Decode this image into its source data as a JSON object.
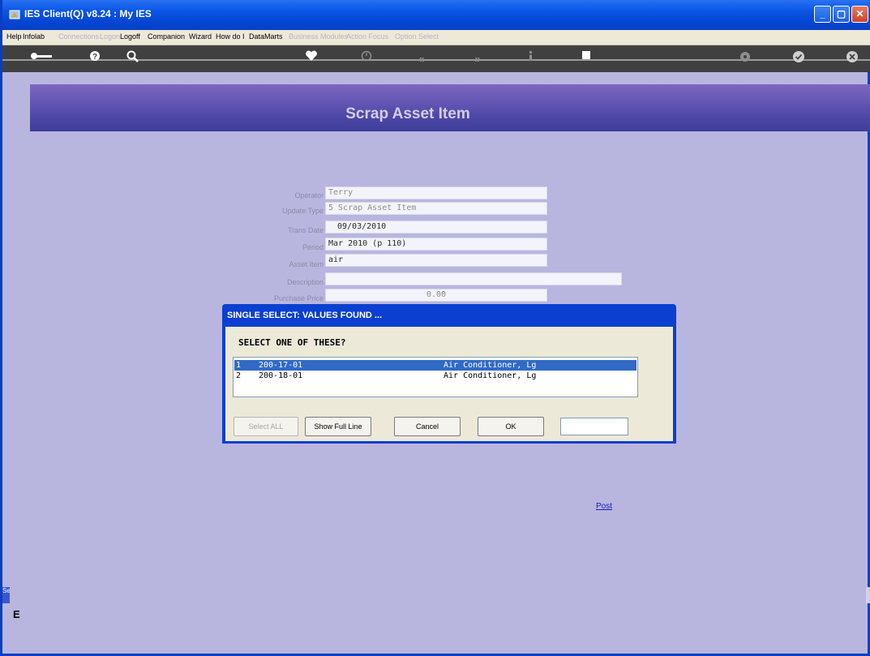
{
  "window": {
    "title": "IES Client(Q) v8.24 : My IES"
  },
  "menu": [
    {
      "label": "Help",
      "enabled": true
    },
    {
      "label": "Infolab",
      "enabled": true
    },
    {
      "label": "Connections",
      "enabled": false
    },
    {
      "label": "Logon",
      "enabled": false
    },
    {
      "label": "Logoff",
      "enabled": true
    },
    {
      "label": "Companion",
      "enabled": true
    },
    {
      "label": "Wizard",
      "enabled": true
    },
    {
      "label": "How do I",
      "enabled": true
    },
    {
      "label": "DataMarts",
      "enabled": true
    },
    {
      "label": "Business Modules",
      "enabled": false
    },
    {
      "label": "Action Focus",
      "enabled": false
    },
    {
      "label": "Option Select",
      "enabled": false
    }
  ],
  "toolbar_icons": [
    "key-icon",
    "help-icon",
    "search-icon",
    "heart-icon",
    "clock-icon",
    "back-icon",
    "forward-icon",
    "info-icon",
    "stop-icon",
    "settings-icon",
    "check-icon",
    "close-icon"
  ],
  "page": {
    "title": "Scrap Asset Item"
  },
  "form": {
    "operator": {
      "label": "Operator",
      "value": "Terry"
    },
    "update_type": {
      "label": "Update Type",
      "value": "5 Scrap Asset Item"
    },
    "trans_date": {
      "label": "Trans Date",
      "value": "09/03/2010"
    },
    "period": {
      "label": "Period",
      "value": "Mar 2010 (p 110)"
    },
    "asset_item": {
      "label": "Asset Item",
      "value": "air"
    },
    "description": {
      "label": "Description",
      "value": ""
    },
    "purchase_price": {
      "label": "Purchase Price",
      "value": "0.00"
    }
  },
  "dialog": {
    "title": "SINGLE SELECT: VALUES FOUND ...",
    "prompt": "SELECT ONE OF THESE?",
    "items": [
      {
        "num": "1",
        "code": "200-17-01",
        "desc": "Air Conditioner, Lg",
        "selected": true
      },
      {
        "num": "2",
        "code": "200-18-01",
        "desc": "Air Conditioner, Lg",
        "selected": false
      }
    ],
    "buttons": {
      "select_all": "Select ALL",
      "show_full_line": "Show Full Line",
      "cancel": "Cancel",
      "ok": "OK"
    },
    "input_value": ""
  },
  "post_link": "Post",
  "side_tab": "Se",
  "side_glyph": "E",
  "colors": {
    "titlebar": "#0b56e8",
    "background": "#b8b6df",
    "banner": "#4a45a4",
    "selection": "#316ac5"
  }
}
